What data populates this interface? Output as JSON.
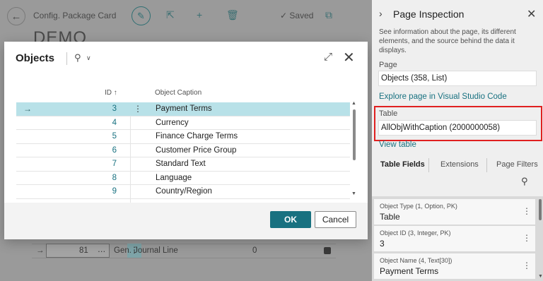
{
  "background_page": {
    "title": "Config. Package Card",
    "heading": "DEMO",
    "saved_label": "Saved",
    "grid_row": {
      "id": "81",
      "caption": "Gen. Journal Line",
      "value": "0"
    }
  },
  "modal": {
    "title": "Objects",
    "columns": {
      "id": "ID ↑",
      "caption": "Object Caption"
    },
    "rows": [
      {
        "id": "3",
        "caption": "Payment Terms",
        "selected": true
      },
      {
        "id": "4",
        "caption": "Currency"
      },
      {
        "id": "5",
        "caption": "Finance Charge Terms"
      },
      {
        "id": "6",
        "caption": "Customer Price Group"
      },
      {
        "id": "7",
        "caption": "Standard Text"
      },
      {
        "id": "8",
        "caption": "Language"
      },
      {
        "id": "9",
        "caption": "Country/Region"
      }
    ],
    "ok_label": "OK",
    "cancel_label": "Cancel"
  },
  "panel": {
    "title": "Page Inspection",
    "description": "See information about the page, its different elements, and the source behind the data it displays.",
    "page_label": "Page",
    "page_value": "Objects (358, List)",
    "explore_link": "Explore page in Visual Studio Code",
    "table_label": "Table",
    "table_value": "AllObjWithCaption (2000000058)",
    "view_table_link": "View table",
    "tabs": [
      "Table Fields",
      "Extensions",
      "Page Filters"
    ],
    "fields": [
      {
        "label": "Object Type (1, Option, PK)",
        "value": "Table"
      },
      {
        "label": "Object ID (3, Integer, PK)",
        "value": "3"
      },
      {
        "label": "Object Name (4, Text[30])",
        "value": "Payment Terms"
      }
    ]
  },
  "colors": {
    "accent": "#187180",
    "selection": "#b8e1e8",
    "highlight": "#e02020"
  }
}
